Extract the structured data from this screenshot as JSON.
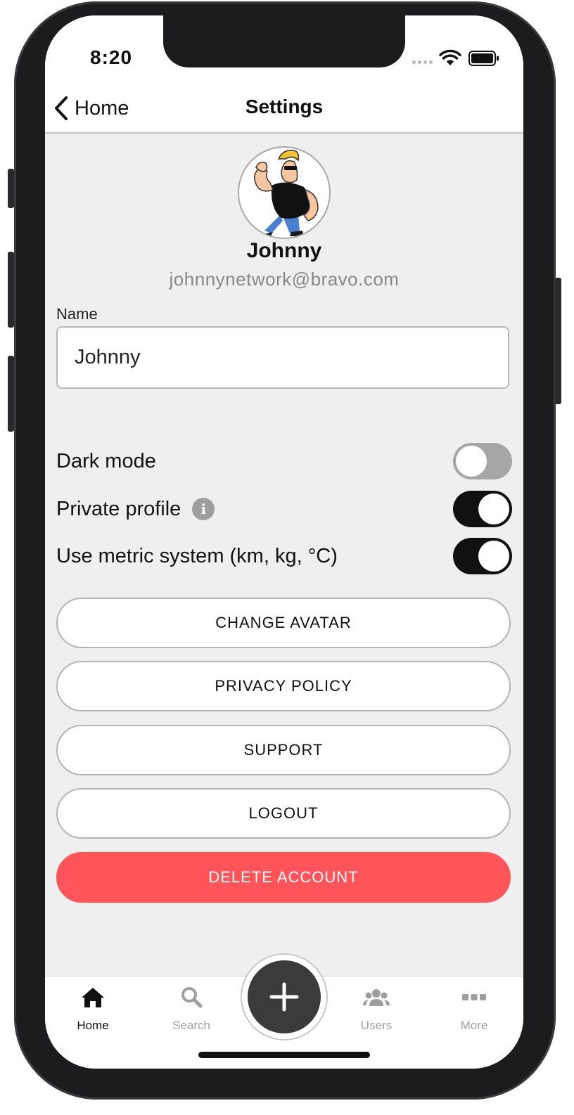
{
  "status_bar": {
    "time": "8:20"
  },
  "nav": {
    "back_label": "Home",
    "title": "Settings"
  },
  "profile": {
    "name": "Johnny",
    "email": "johnnynetwork@bravo.com"
  },
  "form": {
    "name_label": "Name",
    "name_value": "Johnny"
  },
  "toggles": [
    {
      "label": "Dark mode",
      "on": false
    },
    {
      "label": "Private profile",
      "on": true,
      "info_icon": "info-icon"
    },
    {
      "label": "Use metric system (km, kg, °C)",
      "on": true
    }
  ],
  "buttons": {
    "change_avatar": "CHANGE AVATAR",
    "privacy_policy": "PRIVACY POLICY",
    "support": "SUPPORT",
    "logout": "LOGOUT",
    "delete_account": "DELETE ACCOUNT"
  },
  "tab_bar": {
    "items": [
      {
        "label": "Home",
        "icon": "home-icon",
        "active": true
      },
      {
        "label": "Search",
        "icon": "search-icon",
        "active": false
      },
      {
        "label": "Users",
        "icon": "users-icon",
        "active": false
      },
      {
        "label": "More",
        "icon": "more-icon",
        "active": false
      }
    ],
    "fab_icon": "plus-icon"
  },
  "colors": {
    "accent_danger": "#ff5459",
    "toggle_on": "#111111",
    "toggle_off": "#a6a6a6",
    "fab": "#3b3b3b",
    "screen_bg": "#efefef"
  }
}
